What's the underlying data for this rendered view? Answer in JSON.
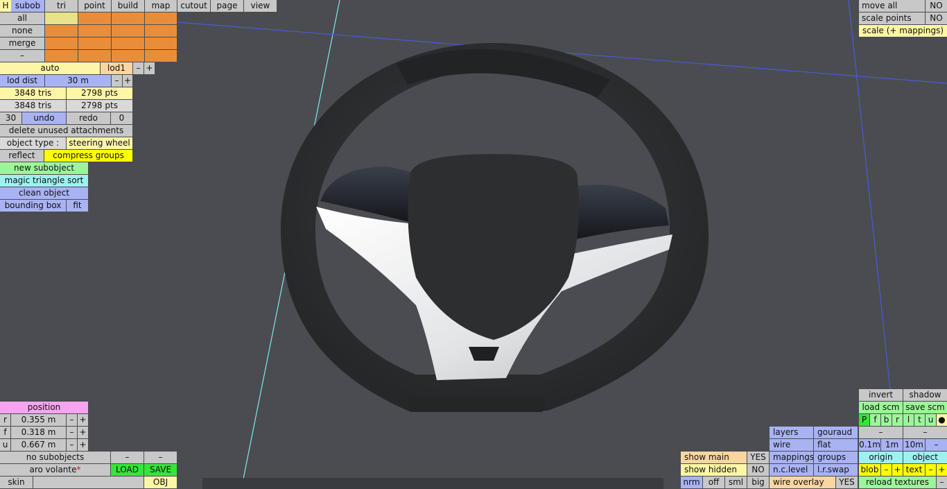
{
  "menu": {
    "h": "H",
    "subob": "subob",
    "tri": "tri",
    "point": "point",
    "build": "build",
    "map": "map",
    "cutout": "cutout",
    "page": "page",
    "view": "view"
  },
  "subob_rows": [
    "all",
    "none",
    "merge",
    "–"
  ],
  "lod": {
    "auto": "auto",
    "lod1": "lod1",
    "minus": "–",
    "plus": "+",
    "dist_label": "lod dist",
    "dist_value": "30 m"
  },
  "stats": {
    "tris1": "3848 tris",
    "pts1": "2798 pts",
    "tris2": "3848 tris",
    "pts2": "2798 pts"
  },
  "undo": {
    "count": "30",
    "undo": "undo",
    "redo": "redo",
    "redo_count": "0"
  },
  "actions": {
    "delete_unused": "delete unused attachments",
    "object_type_label": "object type :",
    "object_type_value": "steering wheel",
    "reflect": "reflect",
    "compress": "compress groups",
    "new_subobject": "new subobject",
    "magic_sort": "magic triangle sort",
    "clean_object": "clean object",
    "bounding_box": "bounding box",
    "fit": "fit"
  },
  "topright": {
    "move_all": "move all",
    "move_all_val": "NO",
    "scale_points": "scale points",
    "scale_points_val": "NO",
    "scale_map": "scale (+ mappings)"
  },
  "position": {
    "title": "position",
    "r_label": "r",
    "r_val": "0.355 m",
    "f_label": "f",
    "f_val": "0.318 m",
    "u_label": "u",
    "u_val": "0.667 m",
    "minus": "–",
    "plus": "+"
  },
  "bottomleft": {
    "no_subobjects": "no subobjects",
    "name": "aro volante",
    "name_mark": "*",
    "load": "LOAD",
    "save": "SAVE",
    "skin": "skin",
    "obj": "OBJ"
  },
  "bottommid": {
    "show_main": "show main",
    "show_main_val": "YES",
    "show_hidden": "show hidden",
    "show_hidden_val": "NO",
    "nrm": "nrm",
    "off": "off",
    "sml": "sml",
    "big": "big"
  },
  "render": {
    "layers": "layers",
    "gouraud": "gouraud",
    "wire": "wire",
    "flat": "flat",
    "mappings": "mappings",
    "groups": "groups",
    "nclevel": "n.c.level",
    "lrswap": "l.r.swap",
    "wire_overlay": "wire overlay",
    "wire_overlay_val": "YES"
  },
  "bottomright": {
    "invert": "invert",
    "shadow": "shadow",
    "load_scm": "load scm",
    "save_scm": "save scm",
    "letters": [
      "P",
      "f",
      "b",
      "r",
      "l",
      "t",
      "u",
      "●"
    ],
    "s01": "0.1m",
    "s1": "1m",
    "s10": "10m",
    "minus": "–",
    "origin": "origin",
    "object": "object",
    "blob": "blob",
    "text": "text",
    "plus": "+",
    "reload": "reload textures"
  },
  "colors": {
    "background": "#4a4c51",
    "wheel": "#2f3031",
    "spokes": "#e9eaec",
    "trim": "#1e2127",
    "guide_cyan": "#7fe8f0",
    "guide_blue": "#4a5ad8"
  }
}
